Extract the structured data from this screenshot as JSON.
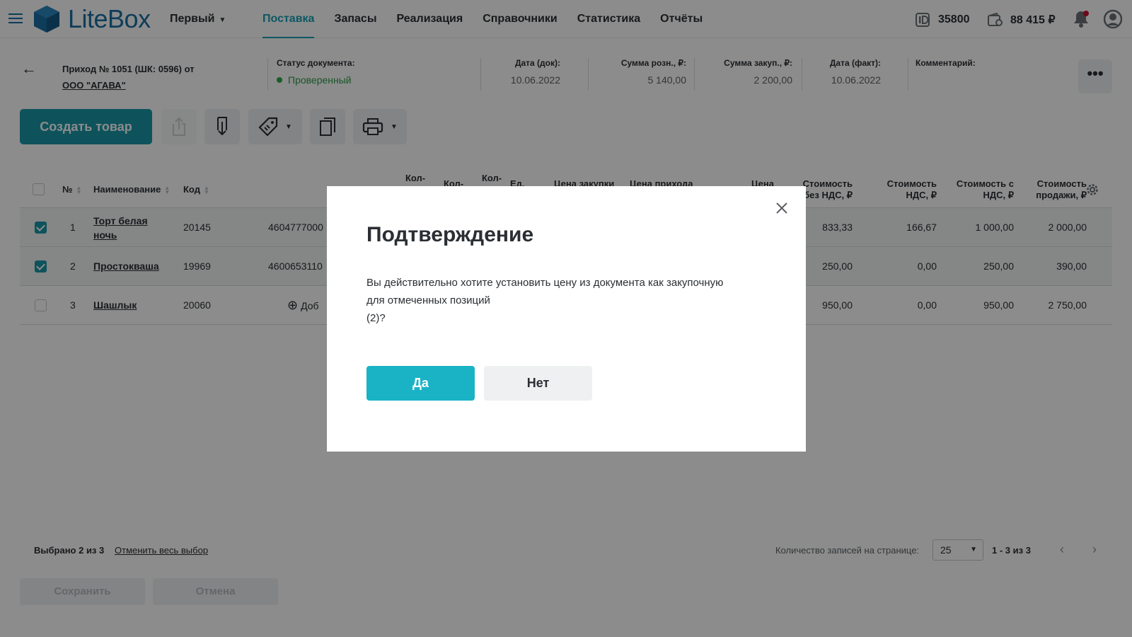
{
  "app": {
    "brand": "LiteBox",
    "store_selector": "Первый",
    "nav": [
      "Поставка",
      "Запасы",
      "Реализация",
      "Справочники",
      "Статистика",
      "Отчёты"
    ],
    "active_nav": "Поставка",
    "account_id": "35800",
    "balance": "88 415 ₽"
  },
  "document": {
    "title": "Приход № 1051 (ШК: 0596) от",
    "supplier": "ООО \"АГАВА\"",
    "status_label": "Статус документа:",
    "status_value": "Проверенный",
    "date_doc_label": "Дата (док):",
    "date_doc": "10.06.2022",
    "sum_retail_label": "Сумма розн., ₽:",
    "sum_retail": "5 140,00",
    "sum_purchase_label": "Сумма закуп., ₽:",
    "sum_purchase": "2 200,00",
    "date_fact_label": "Дата (факт):",
    "date_fact": "10.06.2022",
    "comment_label": "Комментарий:",
    "more": "•••"
  },
  "toolbar": {
    "create_label": "Создать товар"
  },
  "table": {
    "headers": {
      "num": "№",
      "name": "Наименование",
      "code": "Код",
      "qty1": "Кол-",
      "qty2": "Кол-",
      "qty3": "Кол-",
      "unit": "Ед.",
      "price_purchase": "Цена закупки",
      "price_income": "Цена прихода",
      "price": "Цена",
      "cost_no_vat_1": "Стоимость",
      "cost_no_vat_2": "без НДС, ₽",
      "cost_vat_1": "Стоимость",
      "cost_vat_2": "НДС, ₽",
      "cost_with_vat_1": "Стоимость с",
      "cost_with_vat_2": "НДС, ₽",
      "cost_sale_1": "Стоимость",
      "cost_sale_2": "продажи, ₽"
    },
    "rows": [
      {
        "checked": true,
        "num": "1",
        "name_line1": "Торт белая",
        "name_line2": "ночь",
        "code": "20145",
        "barcode": "4604777000",
        "cost_no_vat": "833,33",
        "cost_vat": "166,67",
        "cost_with_vat": "1 000,00",
        "cost_sale": "2 000,00"
      },
      {
        "checked": true,
        "num": "2",
        "name_line1": "Простокваша",
        "name_line2": "",
        "code": "19969",
        "barcode": "4600653110",
        "cost_no_vat": "250,00",
        "cost_vat": "0,00",
        "cost_with_vat": "250,00",
        "cost_sale": "390,00"
      },
      {
        "checked": false,
        "num": "3",
        "name_line1": "Шашлык",
        "name_line2": "",
        "code": "20060",
        "barcode": "Доб",
        "cost_no_vat": "950,00",
        "cost_vat": "0,00",
        "cost_with_vat": "950,00",
        "cost_sale": "2 750,00"
      }
    ]
  },
  "footer": {
    "selected": "Выбрано 2 из 3",
    "clear_selection": "Отменить весь выбор",
    "per_page_label": "Количество записей на странице:",
    "per_page": "25",
    "range": "1 - 3 из 3",
    "save": "Сохранить",
    "cancel": "Отмена"
  },
  "modal": {
    "title": "Подтверждение",
    "text_line1": "Вы действительно хотите установить цену из документа как закупочную",
    "text_line2": "для отмеченных позиций",
    "text_line3": "(2)?",
    "yes": "Да",
    "no": "Нет"
  },
  "colors": {
    "accent": "#1a97a8",
    "brand_blue": "#1a6fa3",
    "status_green": "#2fa84f",
    "overlay": "rgba(0,0,0,0.45)"
  },
  "icons": [
    "menu-icon",
    "litebox-logo-icon",
    "id-icon",
    "wallet-icon",
    "bell-icon",
    "user-icon",
    "back-arrow-icon",
    "upload-icon",
    "download-doc-icon",
    "price-tag-icon",
    "copy-icon",
    "printer-icon",
    "gear-icon",
    "close-icon",
    "add-circle-icon",
    "chevron-left-icon",
    "chevron-right-icon"
  ]
}
